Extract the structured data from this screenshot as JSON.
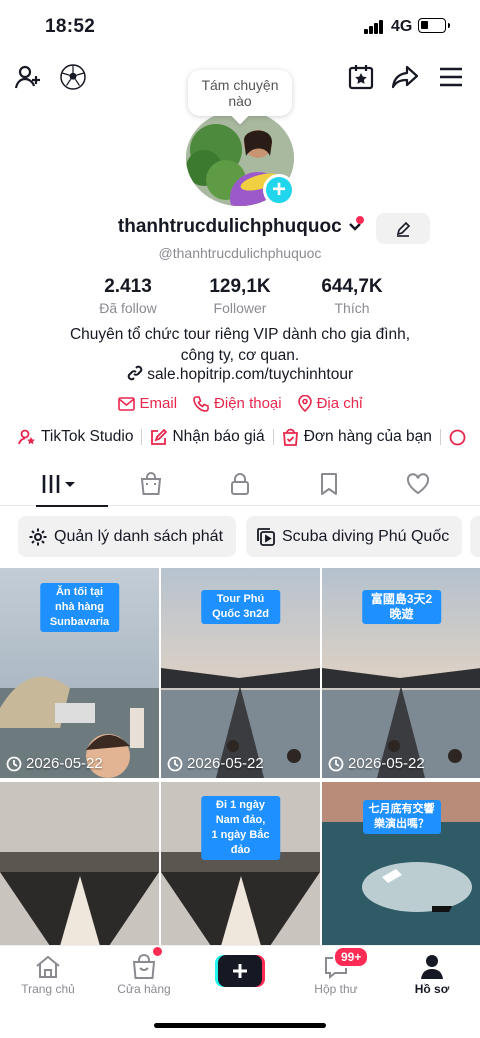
{
  "status_bar": {
    "time": "18:52",
    "network": "4G"
  },
  "bubble": {
    "line1": "Tám chuyện",
    "line2": "nào"
  },
  "profile": {
    "username": "thanhtrucdulichphuquoc",
    "handle": "@thanhtrucdulichphuquoc",
    "stats": [
      {
        "value": "2.413",
        "label": "Đã follow"
      },
      {
        "value": "129,1K",
        "label": "Follower"
      },
      {
        "value": "644,7K",
        "label": "Thích"
      }
    ],
    "bio_line1": "Chuyên tổ chức tour riêng VIP dành cho gia đình,",
    "bio_line2": "công ty, cơ quan.",
    "link": "sale.hopitrip.com/tuychinhtour",
    "contacts": {
      "email": "Email",
      "phone": "Điện thoại",
      "address": "Địa chỉ"
    }
  },
  "tools": {
    "studio": "TikTok Studio",
    "quote": "Nhận báo giá",
    "orders": "Đơn hàng của bạn"
  },
  "playlists": {
    "manage": "Quản lý danh sách phát",
    "scuba": "Scuba diving Phú Quốc"
  },
  "videos": [
    {
      "caption": "Ăn tối tại nhà hàng\nSunbavaria",
      "date": "2026-05-22"
    },
    {
      "caption": "Tour Phú Quốc 3n2d",
      "date": "2026-05-22"
    },
    {
      "caption": "富國島3天2晚遊",
      "date": "2026-05-22"
    },
    {
      "caption": "",
      "date": ""
    },
    {
      "caption": "Đi 1 ngày Nam đảo,\n1 ngày Bắc đảo",
      "date": ""
    },
    {
      "caption": "七月底有交響\n樂演出嗎？",
      "date": ""
    }
  ],
  "bottom_nav": {
    "home": "Trang chủ",
    "shop": "Cửa hàng",
    "inbox": "Hộp thư",
    "inbox_badge": "99+",
    "profile": "Hồ sơ"
  },
  "colors": {
    "accent": "#fe2c55",
    "link_red": "#e8274d",
    "cyan": "#20d5ec"
  }
}
